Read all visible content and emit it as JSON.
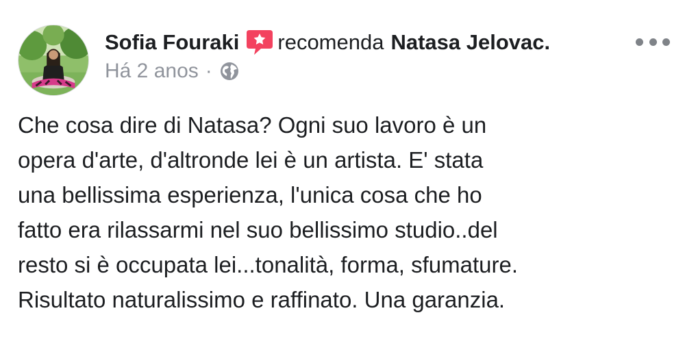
{
  "post": {
    "author": "Sofia Fouraki",
    "action": "recomenda",
    "page": "Natasa Jelovac.",
    "time": "Há 2 anos",
    "separator": "·",
    "privacy_icon": "globe-icon",
    "recommend_icon": "star-speech-bubble-icon",
    "menu_icon": "ellipsis-icon",
    "text_lines": [
      "Che cosa dire di Natasa? Ogni suo lavoro è un",
      "opera d'arte, d'altronde lei è un artista. E' stata",
      "una bellissima esperienza, l'unica cosa che ho",
      "fatto era rilassarmi nel suo bellissimo studio..del",
      "resto si è occupata lei...tonalità, forma, sfumature.",
      "Risultato naturalissimo e raffinato. Una garanzia."
    ]
  },
  "colors": {
    "text": "#1c1e21",
    "meta": "#90949c",
    "recommend_badge": "#f3425f",
    "menu_dots": "#7f8388"
  }
}
